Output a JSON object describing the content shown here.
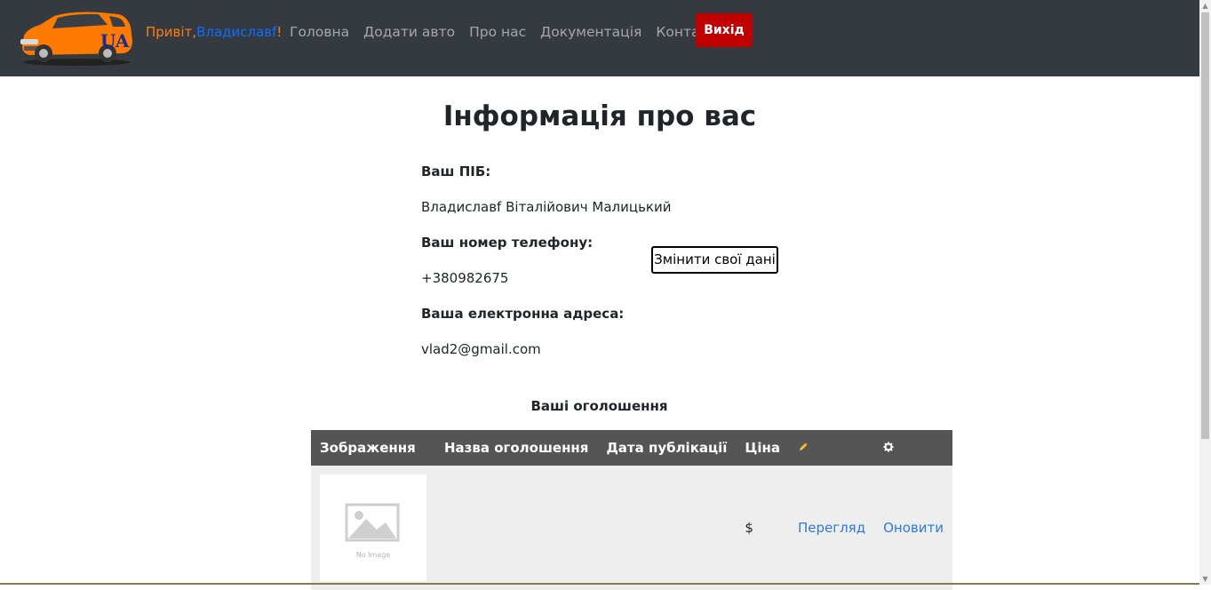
{
  "nav": {
    "greeting_prefix": "Привіт,",
    "username": "Владиславf",
    "greeting_suffix": "!",
    "logo_text": "UA",
    "links": [
      "Головна",
      "Додати авто",
      "Про нас",
      "Документація",
      "Контакти"
    ],
    "logout_label": "Вихід"
  },
  "profile": {
    "title": "Інформація про вас",
    "name_label": "Ваш ПІБ:",
    "name_value": "Владиславf Віталійович Малицький",
    "phone_label": "Ваш номер телефону:",
    "phone_value": "+380982675",
    "email_label": "Ваша електронна адреса:",
    "email_value": "vlad2@gmail.com",
    "edit_button": "Змінити свої дані"
  },
  "ads": {
    "title": "Ваші оголошення",
    "headers": {
      "image": "Зображення",
      "name": "Назва оголошення",
      "date": "Дата публікації",
      "price": "Ціна",
      "edit_icon": "pencil-icon",
      "settings_icon": "gear-icon"
    },
    "rows": [
      {
        "image_caption": "No Image",
        "name": "",
        "date": "",
        "price": "$",
        "view_label": "Перегляд",
        "update_label": "Оновити"
      }
    ]
  },
  "colors": {
    "navbar": "#343a40",
    "logout": "#c00000",
    "link": "#2f7ad6",
    "greeting_name": "#0d6efd",
    "greeting": "#fd7e14",
    "table_header": "#555555"
  }
}
